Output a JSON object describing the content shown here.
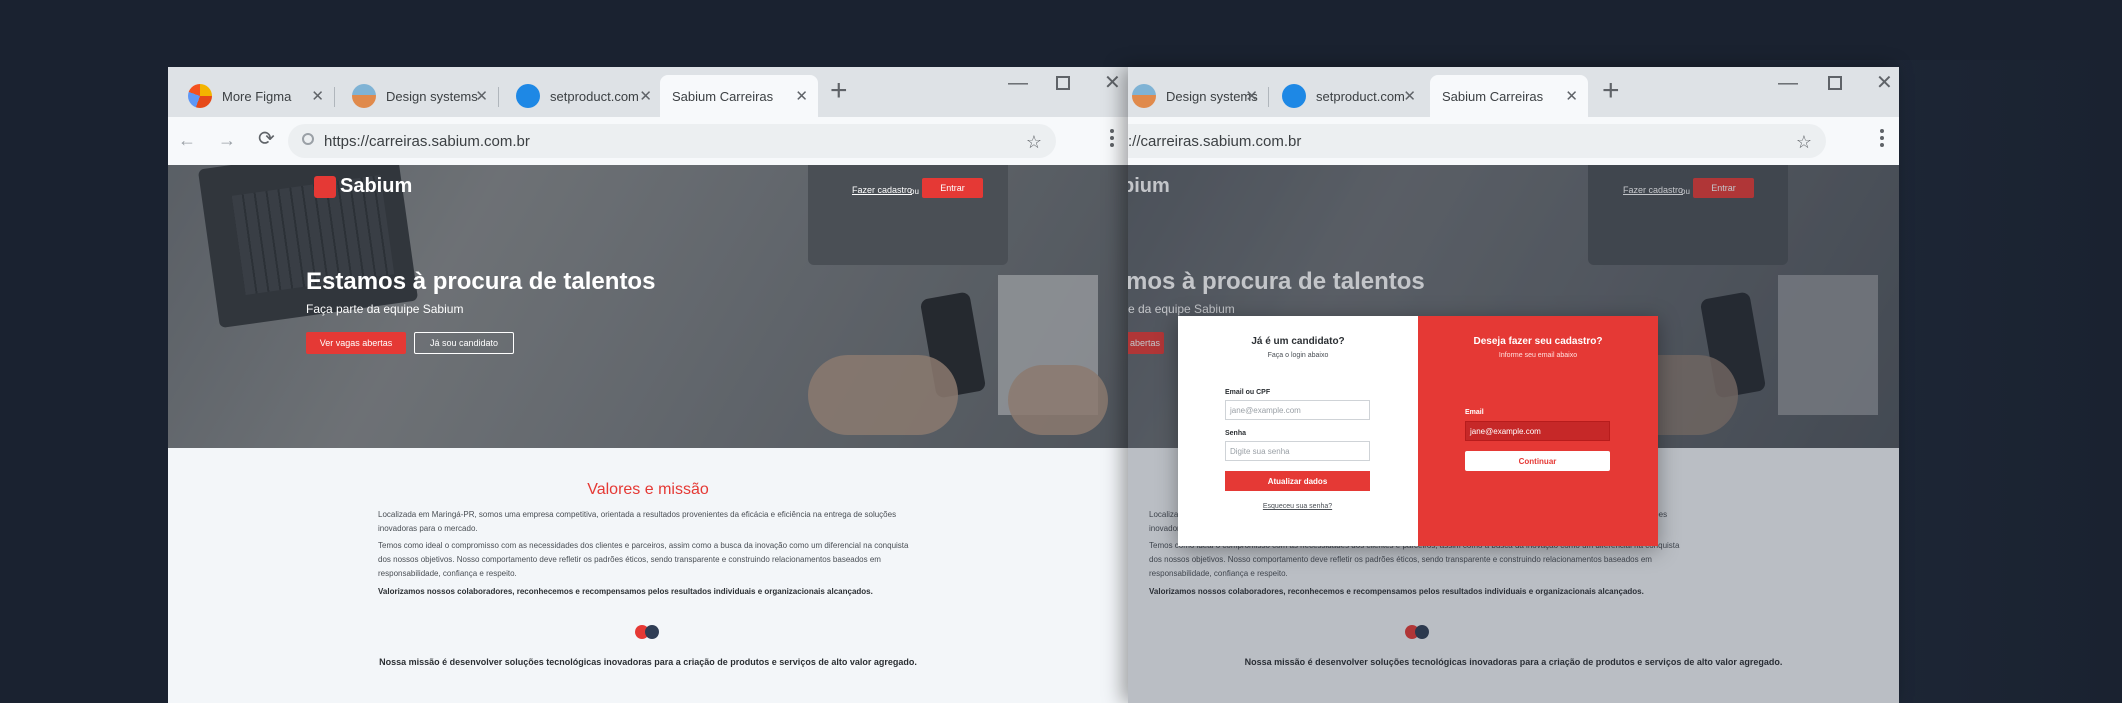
{
  "colors": {
    "accent": "#e53935",
    "chrome": "#dee2e6",
    "dark_bg": "#1a2230"
  },
  "browser_left": {
    "tabs": [
      {
        "label": "More Figma",
        "icon": "figma-favicon"
      },
      {
        "label": "Design systems",
        "icon": "design-systems-favicon"
      },
      {
        "label": "setproduct.com",
        "icon": "setproduct-favicon"
      },
      {
        "label": "Sabium Carreiras",
        "icon": "sabium-favicon",
        "active": true
      }
    ],
    "new_tab": "+",
    "url": "https://carreiras.sabium.com.br"
  },
  "browser_right": {
    "tabs": [
      {
        "label": "Design systems",
        "icon": "design-systems-favicon"
      },
      {
        "label": "setproduct.com",
        "icon": "setproduct-favicon"
      },
      {
        "label": "Sabium Carreiras",
        "icon": "sabium-favicon",
        "active": true
      }
    ],
    "new_tab": "+",
    "url": "://carreiras.sabium.com.br"
  },
  "site": {
    "logo": "Sabium",
    "register_link": "Fazer cadastro",
    "or": "ou",
    "login_button": "Entrar",
    "hero_title": "Estamos à procura de talentos",
    "hero_subtitle": "Faça parte da equipe Sabium",
    "hero_title_cut": "mos à procura de talentos",
    "hero_subtitle_cut": "e da equipe Sabium",
    "cta_jobs": "Ver vagas abertas",
    "cta_jobs_cut": "abertas",
    "cta_candidate": "Já sou candidato",
    "section_title": "Valores e missão",
    "para1": "Localizada em Maringá-PR, somos uma empresa competitiva, orientada a resultados provenientes da eficácia e eficiência na entrega de soluções inovadoras para o mercado.",
    "para2": "Temos como ideal o compromisso com as necessidades dos clientes e parceiros, assim como a busca da inovação como um diferencial na conquista dos nossos objetivos. Nosso comportamento deve refletir os padrões éticos, sendo transparente e construindo relacionamentos baseados em responsabilidade, confiança e respeito.",
    "para3": "Valorizamos nossos colaboradores, reconhecemos e recompensamos pelos resultados individuais e organizacionais alcançados.",
    "mission": "Nossa missão é desenvolver soluções tecnológicas inovadoras para a criação de produtos e serviços de alto valor agregado."
  },
  "modal": {
    "login_title": "Já é um candidato?",
    "login_subtitle": "Faça o login abaixo",
    "email_cpf_label": "Email ou CPF",
    "email_cpf_placeholder": "jane@example.com",
    "password_label": "Senha",
    "password_placeholder": "Digite sua senha",
    "update_button": "Atualizar dados",
    "forgot_link": "Esqueceu sua senha?",
    "signup_title": "Deseja fazer seu cadastro?",
    "signup_subtitle": "Informe seu email abaixo",
    "email_label": "Email",
    "email_value": "jane@example.com",
    "continue_button": "Continuar"
  }
}
